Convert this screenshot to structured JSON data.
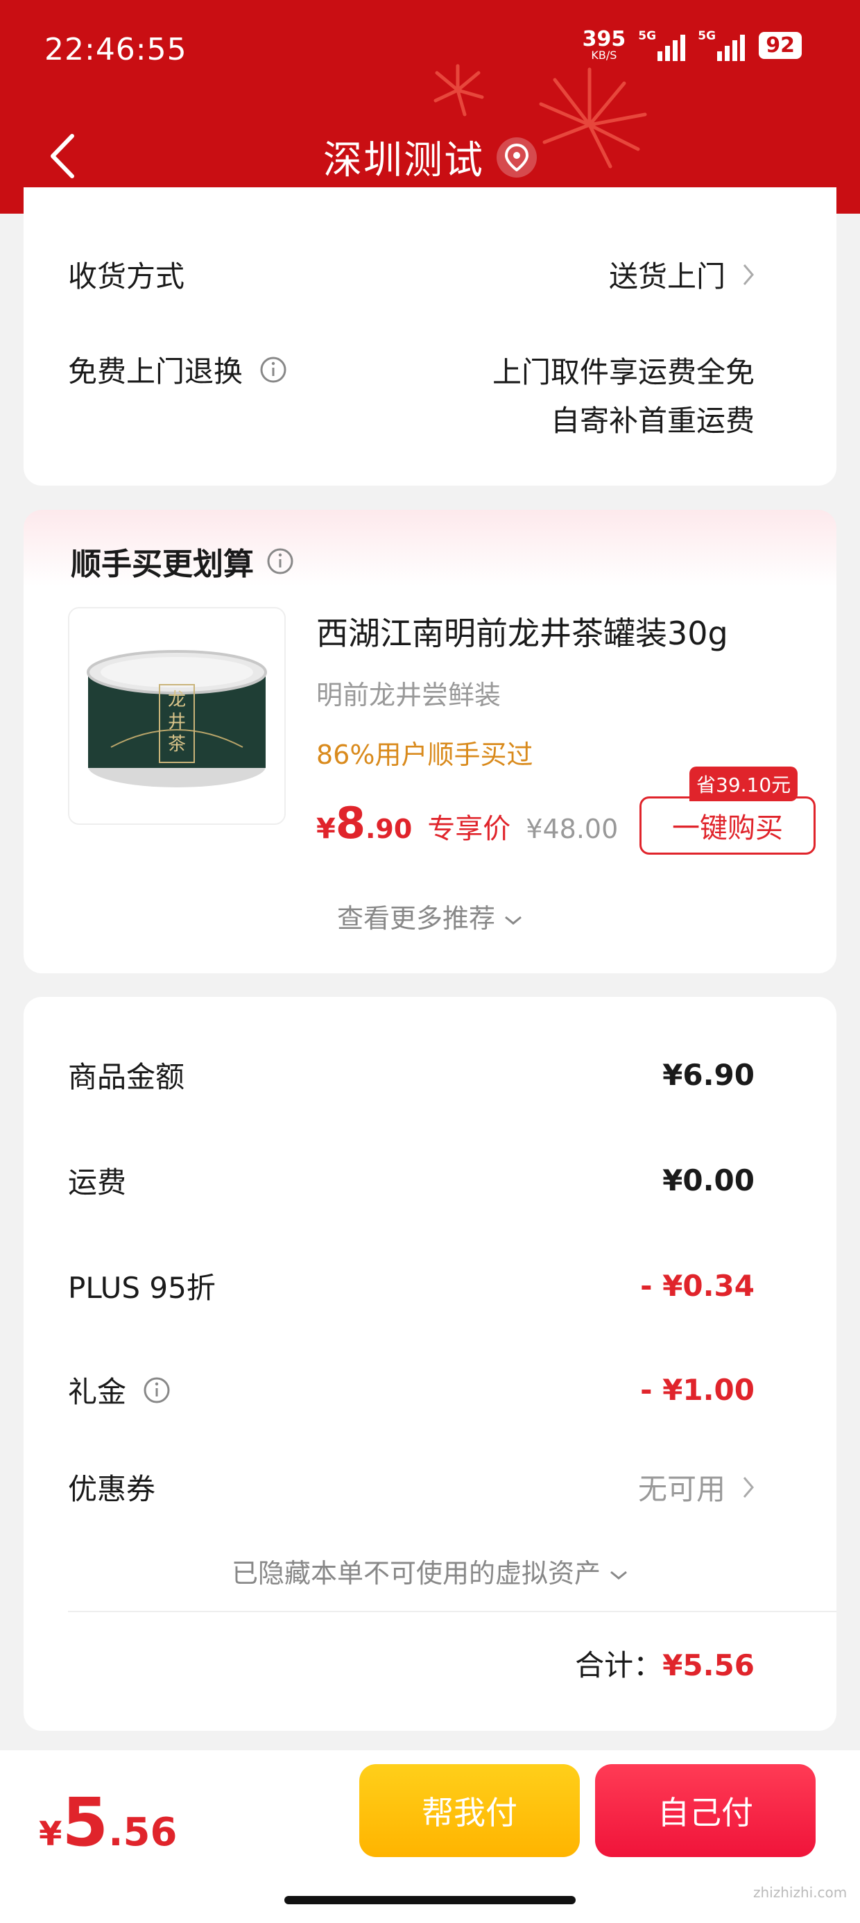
{
  "status_bar": {
    "time": "22:46:55",
    "speed_value": "395",
    "speed_unit": "KB/S",
    "signal1_label": "5G",
    "signal2_label": "5G",
    "battery": "92"
  },
  "header": {
    "title": "深圳测试",
    "back_icon": "chevron-left-icon",
    "location_icon": "location-pin-icon",
    "background_color": "#c90e13"
  },
  "delivery": {
    "method_label": "收货方式",
    "method_value": "送货上门",
    "return_label": "免费上门退换",
    "return_value_line1": "上门取件享运费全免",
    "return_value_line2": "自寄补首重运费"
  },
  "recommend": {
    "title": "顺手买更划算",
    "product": {
      "name": "西湖江南明前龙井茶罐装30g",
      "subtitle": "明前龙井尝鲜装",
      "rate": "86%用户顺手买过",
      "price_currency": "¥",
      "price_integer": "8",
      "price_decimal": ".90",
      "price_tag": "专享价",
      "original_price": "¥48.00",
      "save_badge": "省39.10元",
      "buy_label": "一键购买",
      "can_label": "龙井茶"
    },
    "more_label": "查看更多推荐"
  },
  "summary": {
    "items": [
      {
        "label": "商品金额",
        "value": "¥6.90"
      },
      {
        "label": "运费",
        "value": "¥0.00"
      },
      {
        "label": "PLUS 95折",
        "value": "- ¥0.34"
      },
      {
        "label": "礼金",
        "value": "- ¥1.00"
      },
      {
        "label": "优惠券",
        "value": "无可用"
      }
    ],
    "hidden_note": "已隐藏本单不可使用的虚拟资产",
    "total_label": "合计：",
    "total_value": "¥5.56"
  },
  "bottom_bar": {
    "price_currency": "¥",
    "price_integer": "5",
    "price_decimal": ".56",
    "help_pay_label": "帮我付",
    "self_pay_label": "自己付"
  },
  "watermark": "zhizhizhi.com",
  "colors": {
    "accent_red": "#e0242b",
    "gold": "#d98a1c",
    "yellow_button": "#ffc20e",
    "red_button": "#f0143a"
  }
}
